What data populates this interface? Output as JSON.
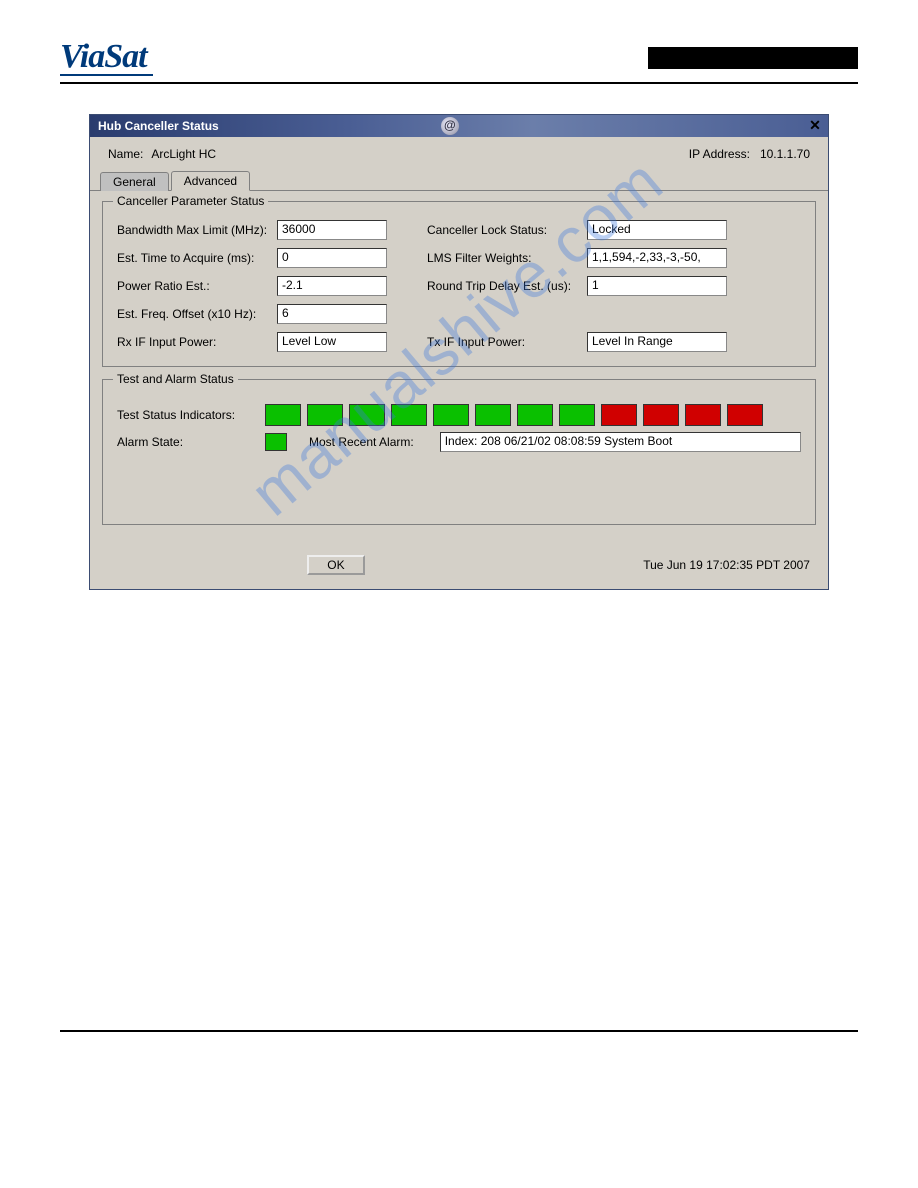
{
  "page": {
    "logo_text": "ViaSat",
    "watermark": "manualshive.com"
  },
  "window": {
    "title": "Hub Canceller Status",
    "name_label": "Name:",
    "name_value": "ArcLight HC",
    "ip_label": "IP Address:",
    "ip_value": "10.1.1.70",
    "tabs": {
      "general": "General",
      "advanced": "Advanced"
    },
    "timestamp": "Tue Jun 19 17:02:35 PDT 2007",
    "ok": "OK"
  },
  "canceller_param_group": {
    "title": "Canceller Parameter Status",
    "left": [
      {
        "label": "Bandwidth Max Limit (MHz):",
        "value": "36000"
      },
      {
        "label": "Est. Time to Acquire (ms):",
        "value": "0"
      },
      {
        "label": "Power Ratio Est.:",
        "value": "-2.1"
      },
      {
        "label": "Est. Freq. Offset (x10 Hz):",
        "value": "6"
      },
      {
        "label": "Rx IF Input Power:",
        "value": "Level Low"
      }
    ],
    "right": [
      {
        "label": "Canceller Lock Status:",
        "value": "Locked"
      },
      {
        "label": "LMS Filter Weights:",
        "value": "1,1,594,-2,33,-3,-50,"
      },
      {
        "label": "Round Trip Delay Est. (us):",
        "value": "1"
      },
      {
        "label": "",
        "value": ""
      },
      {
        "label": "Tx IF Input Power:",
        "value": "Level In Range"
      }
    ]
  },
  "test_alarm_group": {
    "title": "Test and Alarm Status",
    "indicators_label": "Test Status Indicators:",
    "indicators": [
      "green",
      "green",
      "green",
      "green",
      "green",
      "green",
      "green",
      "green",
      "red",
      "red",
      "red",
      "red"
    ],
    "alarm_state_label": "Alarm State:",
    "alarm_state_color": "green",
    "most_recent_label": "Most Recent Alarm:",
    "most_recent_value": "Index: 208 06/21/02 08:08:59 System Boot"
  }
}
